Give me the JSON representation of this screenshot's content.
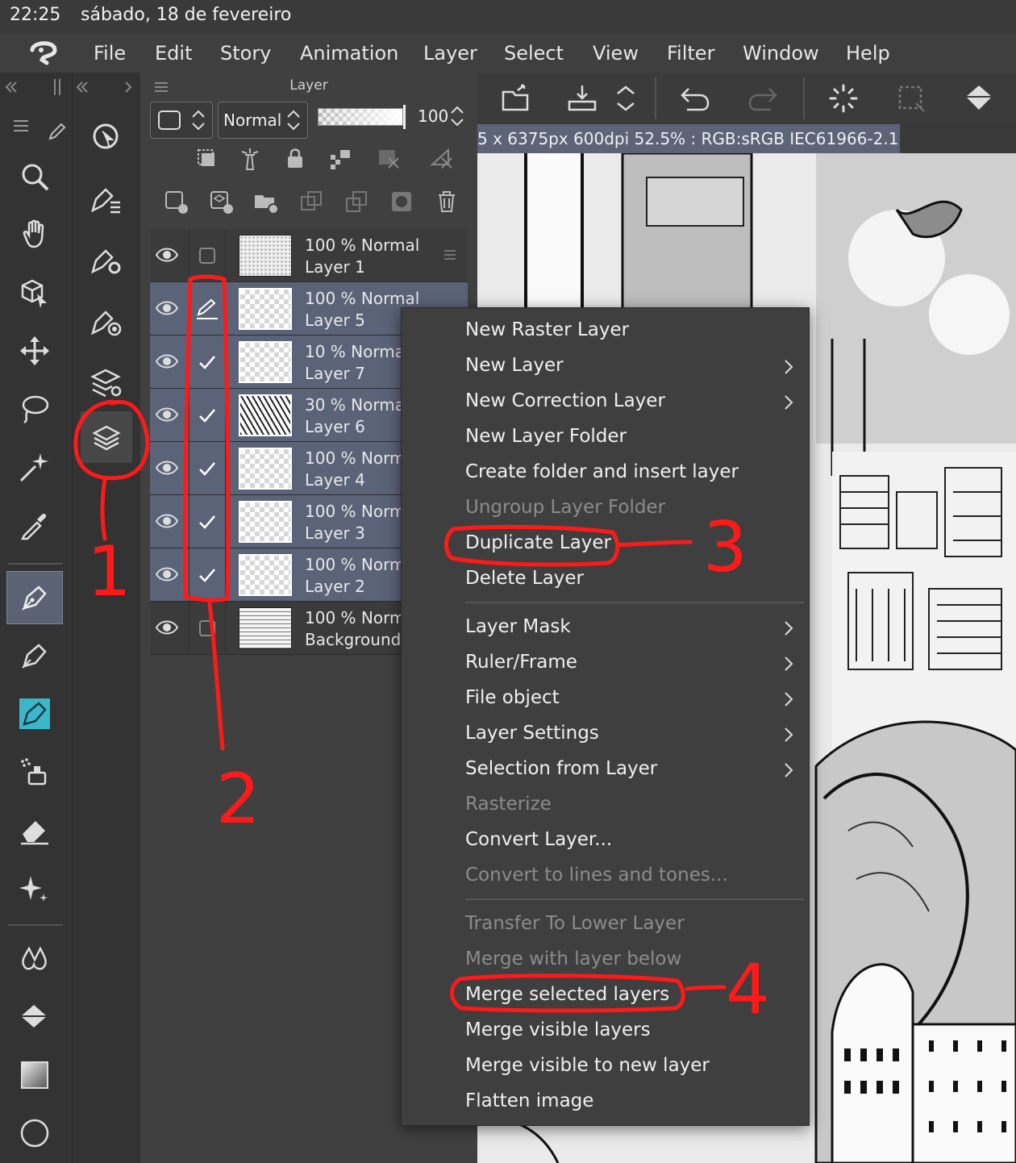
{
  "status": {
    "time": "22:25",
    "date": "sábado, 18 de fevereiro"
  },
  "menu": [
    "File",
    "Edit",
    "Story",
    "Animation",
    "Layer",
    "Select",
    "View",
    "Filter",
    "Window",
    "Help"
  ],
  "panel": {
    "title": "Layer",
    "blend_mode": "Normal",
    "opacity": "100"
  },
  "layers": [
    {
      "opacity_mode": "100 % Normal",
      "name": "Layer 1",
      "check": "empty",
      "selected": false
    },
    {
      "opacity_mode": "100 % Normal",
      "name": "Layer 5",
      "check": "pen",
      "selected": true
    },
    {
      "opacity_mode": "10 % Norma",
      "name": "Layer 7",
      "check": "tick",
      "selected": true
    },
    {
      "opacity_mode": "30 % Norma",
      "name": "Layer 6",
      "check": "tick",
      "selected": true
    },
    {
      "opacity_mode": "100 % Norm",
      "name": "Layer 4",
      "check": "tick",
      "selected": true
    },
    {
      "opacity_mode": "100 % Norm",
      "name": "Layer 3",
      "check": "tick",
      "selected": true
    },
    {
      "opacity_mode": "100 % Norm",
      "name": "Layer 2",
      "check": "tick",
      "selected": true
    },
    {
      "opacity_mode": "100 % Norm",
      "name": "Background",
      "check": "empty",
      "selected": false
    }
  ],
  "canvas_info": "5 x 6375px 600dpi 52.5% : RGB:sRGB IEC61966-2.1)",
  "context_menu": {
    "items": [
      {
        "label": "New Raster Layer",
        "enabled": true,
        "submenu": false
      },
      {
        "label": "New Layer",
        "enabled": true,
        "submenu": true
      },
      {
        "label": "New Correction Layer",
        "enabled": true,
        "submenu": true
      },
      {
        "label": "New Layer Folder",
        "enabled": true,
        "submenu": false
      },
      {
        "label": "Create folder and insert layer",
        "enabled": true,
        "submenu": false
      },
      {
        "label": "Ungroup Layer Folder",
        "enabled": false,
        "submenu": false
      },
      {
        "label": "Duplicate Layer",
        "enabled": true,
        "submenu": false
      },
      {
        "label": "Delete Layer",
        "enabled": true,
        "submenu": false
      },
      {
        "label": "Layer Mask",
        "enabled": true,
        "submenu": true
      },
      {
        "label": "Ruler/Frame",
        "enabled": true,
        "submenu": true
      },
      {
        "label": "File object",
        "enabled": true,
        "submenu": true
      },
      {
        "label": "Layer Settings",
        "enabled": true,
        "submenu": true
      },
      {
        "label": "Selection from Layer",
        "enabled": true,
        "submenu": true
      },
      {
        "label": "Rasterize",
        "enabled": false,
        "submenu": false
      },
      {
        "label": "Convert Layer...",
        "enabled": true,
        "submenu": false
      },
      {
        "label": "Convert to lines and tones...",
        "enabled": false,
        "submenu": false
      },
      {
        "label": "Transfer To Lower Layer",
        "enabled": false,
        "submenu": false
      },
      {
        "label": "Merge with layer below",
        "enabled": false,
        "submenu": false
      },
      {
        "label": "Merge selected layers",
        "enabled": true,
        "submenu": false
      },
      {
        "label": "Merge visible layers",
        "enabled": true,
        "submenu": false
      },
      {
        "label": "Merge visible to new layer",
        "enabled": true,
        "submenu": false
      },
      {
        "label": "Flatten image",
        "enabled": true,
        "submenu": false
      }
    ]
  },
  "annotations": [
    "1",
    "2",
    "3",
    "4"
  ],
  "colors": {
    "annotation": "#ff1a1a",
    "selection": "#5b6378",
    "accent_tool": "#3bb7c9"
  }
}
